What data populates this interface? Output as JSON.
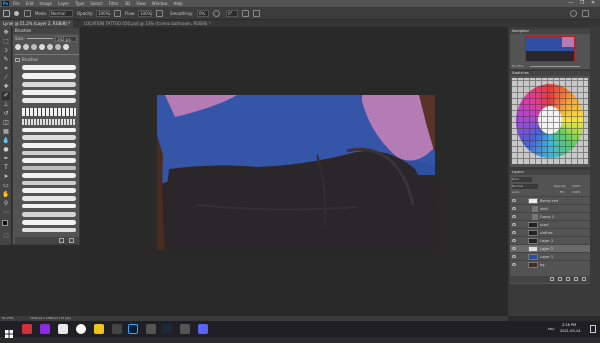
{
  "menubar": {
    "items": [
      "File",
      "Edit",
      "Image",
      "Layer",
      "Type",
      "Select",
      "Filter",
      "3D",
      "View",
      "Window",
      "Help"
    ],
    "window_controls": [
      "—",
      "❐",
      "✕"
    ]
  },
  "options": {
    "mode_label": "Mode:",
    "mode_value": "Normal",
    "opacity_label": "Opacity:",
    "opacity_value": "100%",
    "flow_label": "Flow:",
    "flow_value": "100%",
    "smoothing_label": "Smoothing:",
    "smoothing_value": "0%",
    "angle_value": "0°"
  },
  "document": {
    "tab_title": "Lynel @ 51.2% (Layer 2, RGB/8) *",
    "tab_title_2": "LOCATION TATTOO 050.psd @ 33% (Iconno bathroom, RGB/8) *"
  },
  "brush_panel": {
    "title": "Brushes",
    "size_label": "Size:",
    "size_value": "342 px",
    "folder_label": "Brushes"
  },
  "status": {
    "zoom": "51.23%",
    "doc_info": "1920 px x 1080 px (72 ppi)"
  },
  "navigator": {
    "title": "Navigator",
    "zoom": "51.23%"
  },
  "swatches": {
    "title": "Swatches"
  },
  "layers": {
    "title": "Layers",
    "kind_label": "Kind",
    "blend_mode": "Normal",
    "opacity_label": "Opacity:",
    "opacity_value": "100%",
    "lock_label": "Lock:",
    "fill_label": "Fill:",
    "fill_value": "100%",
    "rows": [
      {
        "name": "Benny red"
      },
      {
        "name": "shirt"
      },
      {
        "name": "Group 1"
      },
      {
        "name": "scarf"
      },
      {
        "name": "clothes"
      },
      {
        "name": "Layer 3"
      },
      {
        "name": "Layer 2"
      },
      {
        "name": "Layer 1"
      },
      {
        "name": "bg"
      }
    ]
  },
  "taskbar": {
    "time": "2:16 PM",
    "date": "2021-03-14",
    "lang": "ENG"
  },
  "colors": {
    "menubar": "#535353",
    "panel": "#535353",
    "canvas_bg": "#292929",
    "shirt_blue": "#2f4fa0",
    "sleeve_pink": "#b57bb4",
    "fabric_dark": "#2a2629",
    "ps_blue": "#31a8ff"
  }
}
